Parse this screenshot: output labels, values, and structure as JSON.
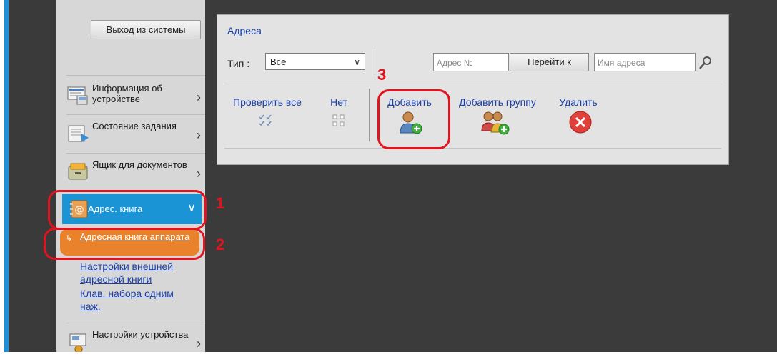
{
  "sidebar": {
    "logout_label": "Выход из системы",
    "items": [
      {
        "label": "Информация об устройстве",
        "icon": "device-info-icon"
      },
      {
        "label": "Состояние задания",
        "icon": "job-status-icon"
      },
      {
        "label": "Ящик для документов",
        "icon": "document-box-icon"
      },
      {
        "label": "Адрес. книга",
        "icon": "address-book-icon"
      },
      {
        "label": "Настройки устройства",
        "icon": "device-settings-icon"
      }
    ],
    "address_book_sub": {
      "active_label": "Адресная книга аппарата",
      "external_label": "Настройки внешней адресной книги",
      "onetouch_label": "Клав. набора одним наж."
    }
  },
  "panel": {
    "title": "Адреса",
    "type_label": "Тип :",
    "type_value": "Все",
    "address_no_placeholder": "Адрес №",
    "goto_label": "Перейти к",
    "address_name_placeholder": "Имя адреса",
    "actions": {
      "check_all": "Проверить все",
      "none": "Нет",
      "add": "Добавить",
      "add_group": "Добавить группу",
      "delete": "Удалить"
    }
  },
  "callouts": {
    "n1": "1",
    "n2": "2",
    "n3": "3"
  },
  "colors": {
    "accent_blue": "#1b94d6",
    "active_orange": "#e9822b",
    "callout_red": "#e0131e",
    "link_blue": "#1a3fa8"
  }
}
